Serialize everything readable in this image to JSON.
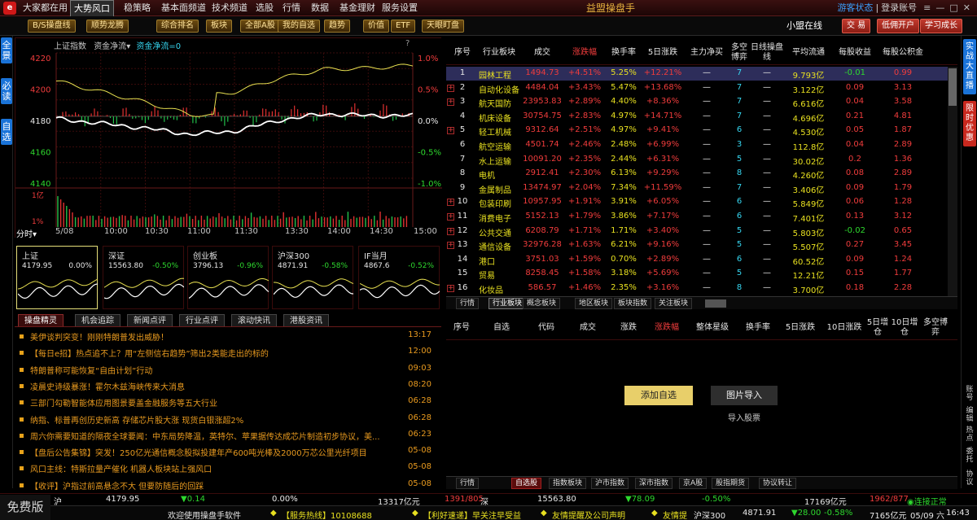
{
  "titlebar": {
    "tabs": [
      "大家都在用",
      "大势风口",
      "稳策略",
      "基本面频道",
      "技术频道",
      "选股",
      "行情",
      "数据",
      "基金理财",
      "服务设置"
    ],
    "app_title": "益盟操盘手",
    "status_link": "游客状态",
    "divider": "|",
    "login_link": "登录账号"
  },
  "toolbar": {
    "buttons": [
      "B/S操盘线",
      "顺势龙腾",
      "综合排名",
      "板块",
      "全部A股",
      "我的自选",
      "趋势",
      "价值",
      "ETF",
      "天眼盯盘"
    ],
    "user": "小盟在线",
    "right_buttons": [
      "交 易",
      "低佣开户",
      "学习成长"
    ]
  },
  "left_tabs": [
    "全景",
    "必读",
    "自选"
  ],
  "right_tabs": [
    "实战大直播",
    "限时优惠"
  ],
  "right_icons": [
    "账号",
    "编辑",
    "热点",
    "委托",
    "协议"
  ],
  "chart": {
    "index_name": "上证指数",
    "flow_label": "资金净流",
    "flow_value": "资金净流=0",
    "help": "?",
    "y_left": [
      "4220",
      "4200",
      "4180",
      "4160",
      "4140"
    ],
    "y_right": [
      "1.0%",
      "0.5%",
      "0.0%",
      "-0.5%",
      "-1.0%"
    ],
    "x_ticks": [
      "5/08",
      "10:00",
      "10:30",
      "11:00",
      "11:30",
      "13:30",
      "14:00",
      "14:30",
      "15:00"
    ],
    "period": "分时",
    "vol_label": "1亿",
    "vol_label2": "1%"
  },
  "chart_data": {
    "type": "line",
    "title": "上证指数",
    "x": [
      "09:30",
      "10:00",
      "10:30",
      "11:00",
      "11:30",
      "13:30",
      "14:00",
      "14:30",
      "15:00"
    ],
    "series": [
      {
        "name": "",
        "values": [
          4178,
          4175,
          4172,
          4168,
          4170,
          4177,
          4181,
          4180,
          4180
        ]
      }
    ],
    "ylim": [
      4140,
      4220
    ]
  },
  "cards": [
    {
      "name": "上证",
      "price": "4179.95",
      "chg": "0.00%",
      "color": "#e8e8e8"
    },
    {
      "name": "深证",
      "price": "15563.80",
      "chg": "-0.50%",
      "color": "#2ed82e"
    },
    {
      "name": "创业板",
      "price": "3796.13",
      "chg": "-0.96%",
      "color": "#2ed82e"
    },
    {
      "name": "沪深300",
      "price": "4871.91",
      "chg": "-0.58%",
      "color": "#2ed82e"
    },
    {
      "name": "IF当月",
      "price": "4867.6",
      "chg": "-0.52%",
      "color": "#2ed82e"
    }
  ],
  "news": {
    "tabs": [
      "操盘精灵",
      "机会追踪",
      "新闻点评",
      "行业点评",
      "滚动快讯",
      "港股资讯"
    ],
    "items": [
      {
        "text": "美伊谈判突变！刚刚特朗普发出威胁！",
        "time": "13:17"
      },
      {
        "text": "【每日e招】热点追不上？用“左侧信右趋势”筛出2类能走出的标的",
        "time": "12:00"
      },
      {
        "text": "特朗普称可能恢复“自由计划”行动",
        "time": "09:03"
      },
      {
        "text": "凌晨史诗级暴涨！霍尔木兹海峡传来大消息",
        "time": "08:20"
      },
      {
        "text": "三部门勾勒智能体应用图景要盖金融服务等五大行业",
        "time": "06:28"
      },
      {
        "text": "纳指、标普再创历史新高 存储芯片股大涨 现货白银涨超2%",
        "time": "06:28"
      },
      {
        "text": "周六你需要知道的隔夜全球要闻：中东局势降温，英特尔、苹果据传达成芯片制造初步协议，美...",
        "time": "06:23"
      },
      {
        "text": "【盘后公告集锦】突发！250亿光通信概念股拟投建年产600吨光棒及2000万芯公里光纤项目",
        "time": "05-08"
      },
      {
        "text": "风口主线：特斯拉量产催化 机器人板块站上强风口",
        "time": "05-08"
      },
      {
        "text": "【收评】沪指过前高悬念不大 但要防随后的回踩",
        "time": "05-08"
      }
    ]
  },
  "sectors": {
    "headers": [
      "序号",
      "行业板块",
      "成交",
      "涨跌幅",
      "换手率",
      "5日涨跌",
      "主力净买",
      "多空博弈",
      "日线操盘线",
      "平均流通",
      "每股收益",
      "每股公积金"
    ],
    "rows": [
      {
        "n": "1",
        "name": "园林工程",
        "vol": "1494.73",
        "chg": "+4.51%",
        "turn": "5.25%",
        "d5": "+12.21%",
        "net": "—",
        "game": "7",
        "line": "—",
        "flow": "9.793亿",
        "eps": "-0.01",
        "cap": "0.99",
        "plus": false
      },
      {
        "n": "2",
        "name": "自动化设备",
        "vol": "4484.04",
        "chg": "+3.43%",
        "turn": "5.47%",
        "d5": "+13.68%",
        "net": "—",
        "game": "7",
        "line": "—",
        "flow": "3.122亿",
        "eps": "0.09",
        "cap": "3.13",
        "plus": true
      },
      {
        "n": "3",
        "name": "航天国防",
        "vol": "23953.83",
        "chg": "+2.89%",
        "turn": "4.40%",
        "d5": "+8.36%",
        "net": "—",
        "game": "7",
        "line": "—",
        "flow": "6.616亿",
        "eps": "0.04",
        "cap": "3.58",
        "plus": true
      },
      {
        "n": "4",
        "name": "机床设备",
        "vol": "30754.75",
        "chg": "+2.83%",
        "turn": "4.97%",
        "d5": "+14.71%",
        "net": "—",
        "game": "7",
        "line": "—",
        "flow": "4.696亿",
        "eps": "0.21",
        "cap": "4.81",
        "plus": false
      },
      {
        "n": "5",
        "name": "轻工机械",
        "vol": "9312.64",
        "chg": "+2.51%",
        "turn": "4.97%",
        "d5": "+9.41%",
        "net": "—",
        "game": "6",
        "line": "—",
        "flow": "4.530亿",
        "eps": "0.05",
        "cap": "1.87",
        "plus": true
      },
      {
        "n": "6",
        "name": "航空运输",
        "vol": "4501.74",
        "chg": "+2.46%",
        "turn": "2.48%",
        "d5": "+6.99%",
        "net": "—",
        "game": "3",
        "line": "—",
        "flow": "112.8亿",
        "eps": "0.04",
        "cap": "2.89",
        "plus": false
      },
      {
        "n": "7",
        "name": "水上运输",
        "vol": "10091.20",
        "chg": "+2.35%",
        "turn": "2.44%",
        "d5": "+6.31%",
        "net": "—",
        "game": "5",
        "line": "—",
        "flow": "30.02亿",
        "eps": "0.2",
        "cap": "1.36",
        "plus": false
      },
      {
        "n": "8",
        "name": "电机",
        "vol": "2912.41",
        "chg": "+2.30%",
        "turn": "6.13%",
        "d5": "+9.29%",
        "net": "—",
        "game": "8",
        "line": "—",
        "flow": "4.260亿",
        "eps": "0.08",
        "cap": "2.89",
        "plus": false
      },
      {
        "n": "9",
        "name": "金属制品",
        "vol": "13474.97",
        "chg": "+2.04%",
        "turn": "7.34%",
        "d5": "+11.59%",
        "net": "—",
        "game": "7",
        "line": "—",
        "flow": "3.406亿",
        "eps": "0.09",
        "cap": "1.79",
        "plus": false
      },
      {
        "n": "10",
        "name": "包装印刷",
        "vol": "10957.95",
        "chg": "+1.91%",
        "turn": "3.91%",
        "d5": "+6.05%",
        "net": "—",
        "game": "6",
        "line": "—",
        "flow": "5.849亿",
        "eps": "0.06",
        "cap": "1.28",
        "plus": true
      },
      {
        "n": "11",
        "name": "消费电子",
        "vol": "5152.13",
        "chg": "+1.79%",
        "turn": "3.86%",
        "d5": "+7.17%",
        "net": "—",
        "game": "6",
        "line": "—",
        "flow": "7.401亿",
        "eps": "0.13",
        "cap": "3.12",
        "plus": true
      },
      {
        "n": "12",
        "name": "公共交通",
        "vol": "6208.79",
        "chg": "+1.71%",
        "turn": "1.71%",
        "d5": "+3.40%",
        "net": "—",
        "game": "5",
        "line": "—",
        "flow": "5.803亿",
        "eps": "-0.02",
        "cap": "0.65",
        "plus": true
      },
      {
        "n": "13",
        "name": "通信设备",
        "vol": "32976.28",
        "chg": "+1.63%",
        "turn": "6.21%",
        "d5": "+9.16%",
        "net": "—",
        "game": "5",
        "line": "—",
        "flow": "5.507亿",
        "eps": "0.27",
        "cap": "3.45",
        "plus": true
      },
      {
        "n": "14",
        "name": "港口",
        "vol": "3751.03",
        "chg": "+1.59%",
        "turn": "0.70%",
        "d5": "+2.89%",
        "net": "—",
        "game": "6",
        "line": "—",
        "flow": "60.52亿",
        "eps": "0.09",
        "cap": "1.24",
        "plus": false
      },
      {
        "n": "15",
        "name": "贸易",
        "vol": "8258.45",
        "chg": "+1.58%",
        "turn": "3.18%",
        "d5": "+5.69%",
        "net": "—",
        "game": "5",
        "line": "—",
        "flow": "12.21亿",
        "eps": "0.15",
        "cap": "1.77",
        "plus": false
      },
      {
        "n": "16",
        "name": "化妆品",
        "vol": "586.57",
        "chg": "+1.46%",
        "turn": "2.35%",
        "d5": "+3.16%",
        "net": "—",
        "game": "8",
        "line": "—",
        "flow": "3.700亿",
        "eps": "0.18",
        "cap": "2.28",
        "plus": true
      }
    ],
    "bottom_tabs": [
      "行情",
      "行业板块",
      "概念板块",
      "地区板块",
      "板块指数",
      "关注板块"
    ]
  },
  "watchlist": {
    "headers": [
      "序号",
      "自选",
      "代码",
      "成交",
      "涨跌",
      "涨跌幅",
      "整体星级",
      "换手率",
      "5日涨跌",
      "10日涨跌",
      "5日增仓",
      "10日增仓",
      "多空博弈"
    ],
    "add_button": "添加自选",
    "image_button": "图片导入",
    "import_label": "导入股票",
    "bottom_tabs": [
      "行情",
      "自选股",
      "指数板块",
      "沪市指数",
      "深市指数",
      "京A股",
      "股指期货",
      "协议转让"
    ]
  },
  "status": {
    "market1": "沪",
    "idx1": "4179.95",
    "chg1": "▼0.14",
    "pct1": "0.00%",
    "amt1": "13317亿元",
    "ratio1": "1391/805",
    "market2": "深",
    "idx2": "15563.80",
    "chg2": "▼78.09",
    "pct2": "-0.50%",
    "amt2": "17169亿元",
    "ratio2": "1962/877",
    "conn": "连接正常",
    "free": "免费版",
    "welcome": "欢迎使用操盘手软件",
    "hotline": "【服务热线】10108688",
    "notice": "【利好速递】早关注早受益",
    "tip": "友情提醒及公司声明",
    "tip2": "友情提",
    "market3": "沪深300",
    "idx3": "4871.91",
    "chg3": "▼28.00",
    "pct3": "-0.58%",
    "amt3": "7165亿元",
    "date": "05/09 六",
    "time": "16:43"
  }
}
